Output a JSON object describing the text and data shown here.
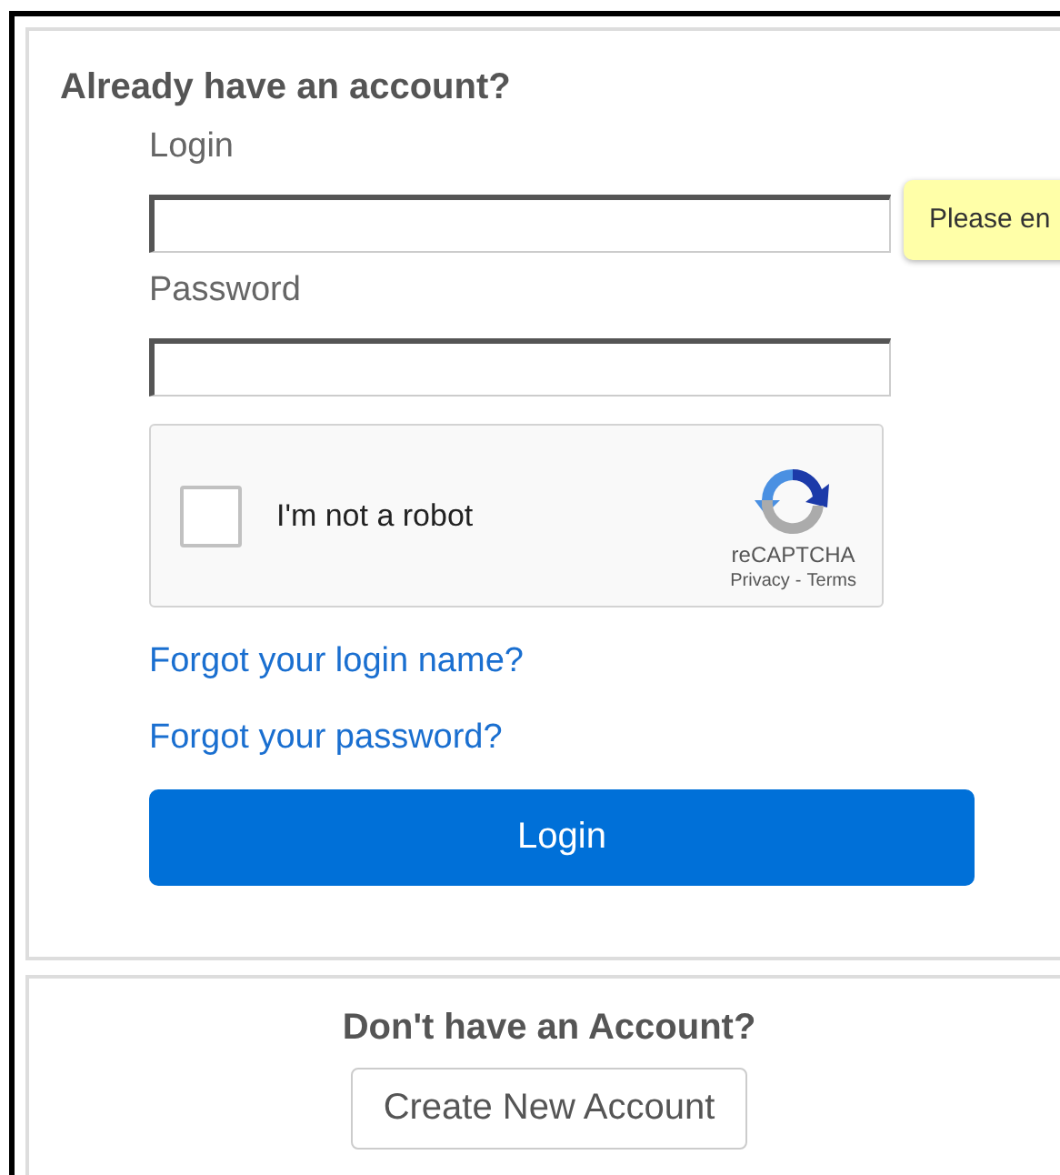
{
  "login_panel": {
    "heading": "Already have an account?",
    "fields": [
      {
        "label": "Login",
        "tooltip": "Please en"
      },
      {
        "label": "Password"
      }
    ],
    "captcha": {
      "label": "I'm not a robot",
      "checked": false,
      "brand": "reCAPTCHA",
      "privacy": "Privacy",
      "separator": "-",
      "terms": "Terms"
    },
    "links": [
      "Forgot your login name?",
      "Forgot your password?"
    ],
    "button": "Login"
  },
  "signup_panel": {
    "heading": "Don't have an Account?",
    "button": "Create New Account"
  }
}
